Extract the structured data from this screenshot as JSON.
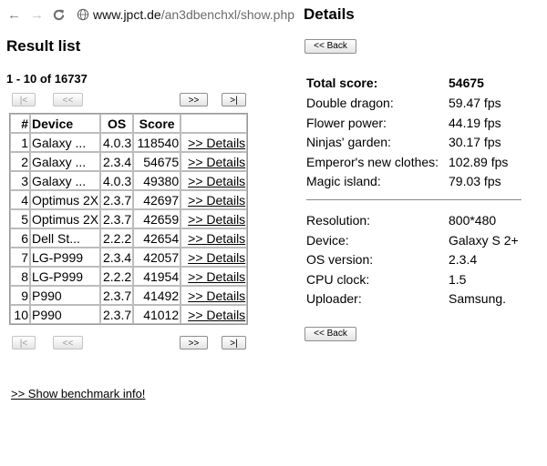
{
  "browser": {
    "url_host": "www.jpct.de",
    "url_path": "/an3dbenchxl/show.php",
    "icons": [
      "back-arrow-icon",
      "forward-arrow-icon",
      "reload-icon",
      "globe-icon"
    ]
  },
  "left": {
    "title": "Result list",
    "count_text": "1 - 10 of 16737",
    "pager": {
      "first": "|<",
      "prev": "<<",
      "next": ">>",
      "last": ">|"
    },
    "columns": [
      "#",
      "Device",
      "OS",
      "Score",
      ""
    ],
    "rows": [
      {
        "num": "1",
        "device": "Galaxy ...",
        "os": "4.0.3",
        "score": "118540",
        "link": ">> Details"
      },
      {
        "num": "2",
        "device": "Galaxy ...",
        "os": "2.3.4",
        "score": "54675",
        "link": ">> Details"
      },
      {
        "num": "3",
        "device": "Galaxy ...",
        "os": "4.0.3",
        "score": "49380",
        "link": ">> Details"
      },
      {
        "num": "4",
        "device": "Optimus 2X",
        "os": "2.3.7",
        "score": "42697",
        "link": ">> Details"
      },
      {
        "num": "5",
        "device": "Optimus 2X",
        "os": "2.3.7",
        "score": "42659",
        "link": ">> Details"
      },
      {
        "num": "6",
        "device": "Dell St...",
        "os": "2.2.2",
        "score": "42654",
        "link": ">> Details"
      },
      {
        "num": "7",
        "device": "LG-P999",
        "os": "2.3.4",
        "score": "42057",
        "link": ">> Details"
      },
      {
        "num": "8",
        "device": "LG-P999",
        "os": "2.2.2",
        "score": "41954",
        "link": ">> Details"
      },
      {
        "num": "9",
        "device": "P990",
        "os": "2.3.7",
        "score": "41492",
        "link": ">> Details"
      },
      {
        "num": "10",
        "device": "P990",
        "os": "2.3.7",
        "score": "41012",
        "link": ">> Details"
      }
    ],
    "show_info": ">> Show benchmark info!"
  },
  "details": {
    "title": "Details",
    "back_label": "<< Back",
    "total": {
      "label": "Total score:",
      "value": "54675"
    },
    "scores": [
      {
        "label": "Double dragon:",
        "value": "59.47 fps"
      },
      {
        "label": "Flower power:",
        "value": "44.19 fps"
      },
      {
        "label": "Ninjas' garden:",
        "value": "30.17 fps"
      },
      {
        "label": "Emperor's new clothes:",
        "value": "102.89 fps"
      },
      {
        "label": "Magic island:",
        "value": "79.03 fps"
      }
    ],
    "info": [
      {
        "label": "Resolution:",
        "value": "800*480"
      },
      {
        "label": "Device:",
        "value": "Galaxy S 2+"
      },
      {
        "label": "OS version:",
        "value": "2.3.4"
      },
      {
        "label": "CPU clock:",
        "value": "1.5"
      },
      {
        "label": "Uploader:",
        "value": "Samsung."
      }
    ]
  }
}
